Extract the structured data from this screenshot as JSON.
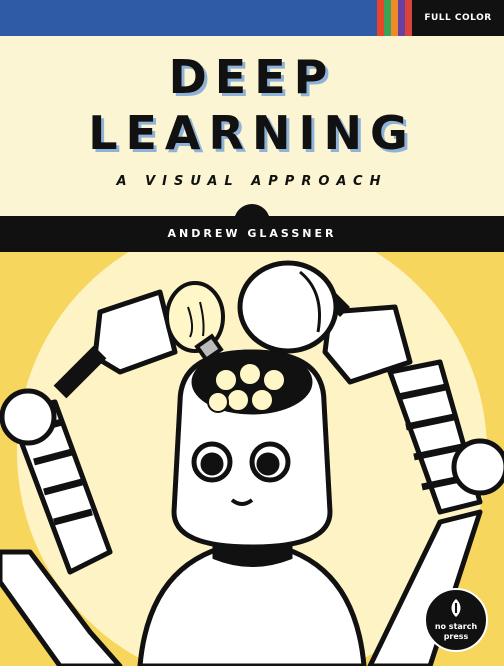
{
  "badge": {
    "label": "FULL COLOR"
  },
  "stripe_colors": [
    "#e8452a",
    "#3aa35a",
    "#f08a24",
    "#6b3fa0",
    "#d8443a"
  ],
  "cover": {
    "title_line1": "DEEP",
    "title_line2": "LEARNING",
    "subtitle": "A VISUAL APPROACH",
    "author": "ANDREW GLASSNER"
  },
  "publisher": {
    "line1": "no starch",
    "line2": "press"
  },
  "colors": {
    "top_band": "#2f5aa6",
    "title_bg": "#fbf5d3",
    "illustration_bg": "#f7d65e",
    "halo": "#fdf3c4"
  }
}
